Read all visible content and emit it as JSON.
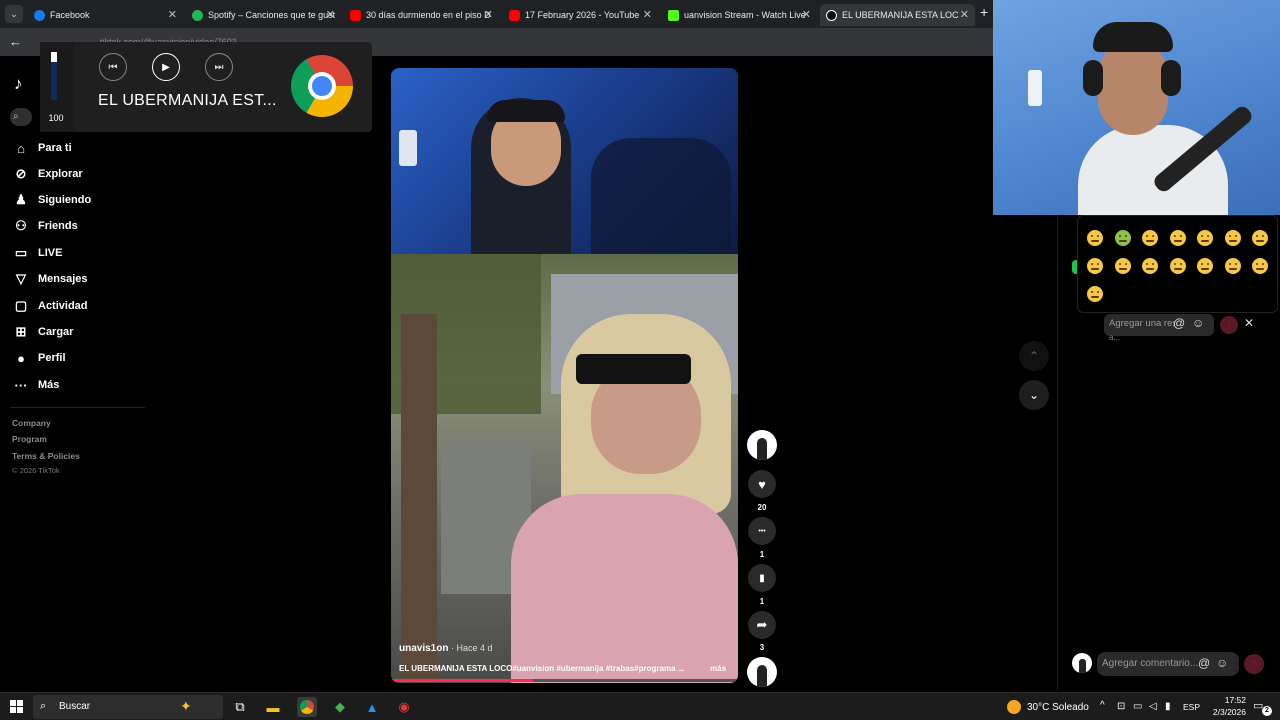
{
  "browser": {
    "tabs": [
      {
        "title": "Facebook",
        "color": "#1877f2"
      },
      {
        "title": "Spotify – Canciones que te gust",
        "color": "#1db954"
      },
      {
        "title": "30 días durmiendo en el piso D",
        "color": "#ff0000"
      },
      {
        "title": "17 February 2026 - YouTube",
        "color": "#ff0000"
      },
      {
        "title": "uanvision Stream - Watch Live",
        "color": "#53fc18"
      },
      {
        "title": "EL UBERMANIJA ESTA LOC",
        "color": "#ffffff"
      }
    ],
    "new_tab_label": "+",
    "back_label": "←",
    "url_text": "tiktok.com/@uanvision/video/7603"
  },
  "media_overlay": {
    "title": "EL UBERMANIJA EST...",
    "volume": "100",
    "volume_level": 1.0,
    "prev_label": "⏮",
    "play_label": "▶",
    "next_label": "⏭"
  },
  "tiktok": {
    "logo_text": "♪",
    "search_glyph": "⌕",
    "nav": [
      {
        "label": "Para ti",
        "icon": "⌂"
      },
      {
        "label": "Explorar",
        "icon": "⊘"
      },
      {
        "label": "Siguiendo",
        "icon": "♟"
      },
      {
        "label": "Friends",
        "icon": "⚇"
      },
      {
        "label": "LIVE",
        "icon": "▭"
      },
      {
        "label": "Mensajes",
        "icon": "▽"
      },
      {
        "label": "Actividad",
        "icon": "▢"
      },
      {
        "label": "Cargar",
        "icon": "⊞"
      },
      {
        "label": "Perfil",
        "icon": "●"
      },
      {
        "label": "Más",
        "icon": "···"
      }
    ],
    "footer": {
      "company": "Company",
      "program": "Program",
      "terms": "Terms & Policies",
      "copyright": "© 2026 TikTok"
    }
  },
  "video": {
    "author": "unavis1on",
    "time_ago": " · Hace 4 d",
    "caption": "EL UBERMANIJA ESTA LOCO#uanvision #ubermanija #trabas#programa ...",
    "more_label": "más",
    "progress": 0.41,
    "likes": "20",
    "comments": "1",
    "saves": "1",
    "shares": "3",
    "like_icon": "♥",
    "comment_icon": "•••",
    "save_icon": "▮",
    "share_icon": "➦"
  },
  "feed_nav": {
    "up_label": "⌃",
    "down_label": "⌄"
  },
  "comments": {
    "reply_placeholder": "Agregar una respuesta...",
    "reply_overflow": "a...",
    "comment_placeholder": "Agregar comentario...",
    "at_label": "@",
    "emoji_label": "☺",
    "send_label": "↑",
    "close_label": "✕"
  },
  "taskbar": {
    "search_label": "Buscar",
    "search_icon": "⌕",
    "spark_icon": "✦",
    "weather": "30°C  Soleado",
    "lang": "ESP",
    "time": "17:52",
    "date": "2/3/2026",
    "notif_count": "2",
    "tray_chevron": "^",
    "notif_icon": "▭"
  },
  "colors": {
    "accent": "#fe2c55",
    "tiktok_bg": "#000000",
    "taskbar_bg": "#1c1c1c"
  }
}
